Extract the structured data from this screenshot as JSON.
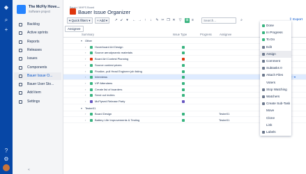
{
  "colors": {
    "global_nav": "#0747a6",
    "accent": "#0052cc",
    "status_green": "#36b37e",
    "story_green": "#36b37e",
    "bug_red": "#de350b",
    "epic_purple": "#6554c0"
  },
  "global_nav": {
    "icons": [
      "jira-logo-icon",
      "search-icon",
      "plus-icon",
      "help-icon",
      "settings-icon"
    ]
  },
  "project": {
    "name": "The McFly Hove...",
    "type": "Software project"
  },
  "sidebar": {
    "items": [
      {
        "label": "Backlog",
        "icon": "backlog-icon"
      },
      {
        "label": "Active sprints",
        "icon": "board-icon"
      },
      {
        "label": "Reports",
        "icon": "reports-icon"
      },
      {
        "label": "Releases",
        "icon": "releases-icon"
      },
      {
        "label": "Issues",
        "icon": "issues-icon"
      },
      {
        "label": "Components",
        "icon": "components-icon"
      },
      {
        "label": "Bauer Issue O...",
        "icon": "app-icon",
        "active": true
      },
      {
        "label": "Bauer User Sto...",
        "icon": "app-icon"
      },
      {
        "label": "Add item",
        "icon": "plus-icon"
      },
      {
        "label": "Settings",
        "icon": "gear-icon"
      }
    ]
  },
  "header": {
    "breadcrumb": "Bauer / MHFS Board",
    "title": "Bauer Issue Organizer"
  },
  "toolbar": {
    "quick_filters": "Quick filters",
    "add": "Add",
    "search_placeholder": "Search...",
    "export": "Export"
  },
  "filter_chip": "Assignee",
  "table": {
    "columns": [
      "Summary",
      "Issue Type",
      "Progress",
      "Assignee"
    ],
    "groups": [
      {
        "label": "Other",
        "rows": [
          {
            "summary": "Hoverboard Art Design",
            "type": "story",
            "assignee": ""
          },
          {
            "summary": "Source aerodynamic materials",
            "type": "story",
            "assignee": ""
          },
          {
            "summary": "Board Art Contest Planning",
            "type": "bug",
            "assignee": ""
          },
          {
            "summary": "Source contest prizes",
            "type": "story",
            "assignee": ""
          },
          {
            "summary": "Finalize, pull Head Engineer job listing",
            "type": "story",
            "assignee": ""
          },
          {
            "summary": "Interviews",
            "type": "story",
            "assignee": "",
            "selected": true
          },
          {
            "summary": "VIP Attendees",
            "type": "story",
            "assignee": ""
          },
          {
            "summary": "Create list of boarders",
            "type": "story",
            "assignee": ""
          },
          {
            "summary": "Send out invites",
            "type": "story",
            "assignee": ""
          },
          {
            "summary": "McFlysed Release Party",
            "type": "epic",
            "assignee": ""
          }
        ]
      },
      {
        "label": "Tester01",
        "rows": [
          {
            "summary": "Board Design",
            "type": "story",
            "assignee": "Tester01"
          },
          {
            "summary": "Battery Life Improvements & Testing",
            "type": "story",
            "assignee": "Tester01"
          }
        ]
      }
    ]
  },
  "context_menu": {
    "items": [
      {
        "label": "Done",
        "icon": "status-icon"
      },
      {
        "label": "In Progress",
        "icon": "status-icon"
      },
      {
        "label": "To Do",
        "icon": "status-icon"
      },
      {
        "label": "Edit",
        "icon": "edit-icon"
      },
      {
        "label": "Assign",
        "icon": "user-icon",
        "highlight": true
      },
      {
        "label": "Comment",
        "icon": "comment-icon"
      },
      {
        "label": "Subtasks 0",
        "icon": "plus-icon"
      },
      {
        "label": "Attach Files",
        "icon": "paperclip-icon"
      },
      {
        "label": "Voters",
        "icon": ""
      },
      {
        "label": "Stop Watching",
        "icon": "eye-icon"
      },
      {
        "label": "Watchers",
        "icon": "eye-icon"
      },
      {
        "label": "Create Sub-Task",
        "icon": "plus-icon"
      },
      {
        "label": "Move",
        "icon": ""
      },
      {
        "label": "Clone",
        "icon": ""
      },
      {
        "label": "Link",
        "icon": ""
      },
      {
        "label": "Labels",
        "icon": "tag-icon"
      }
    ]
  }
}
